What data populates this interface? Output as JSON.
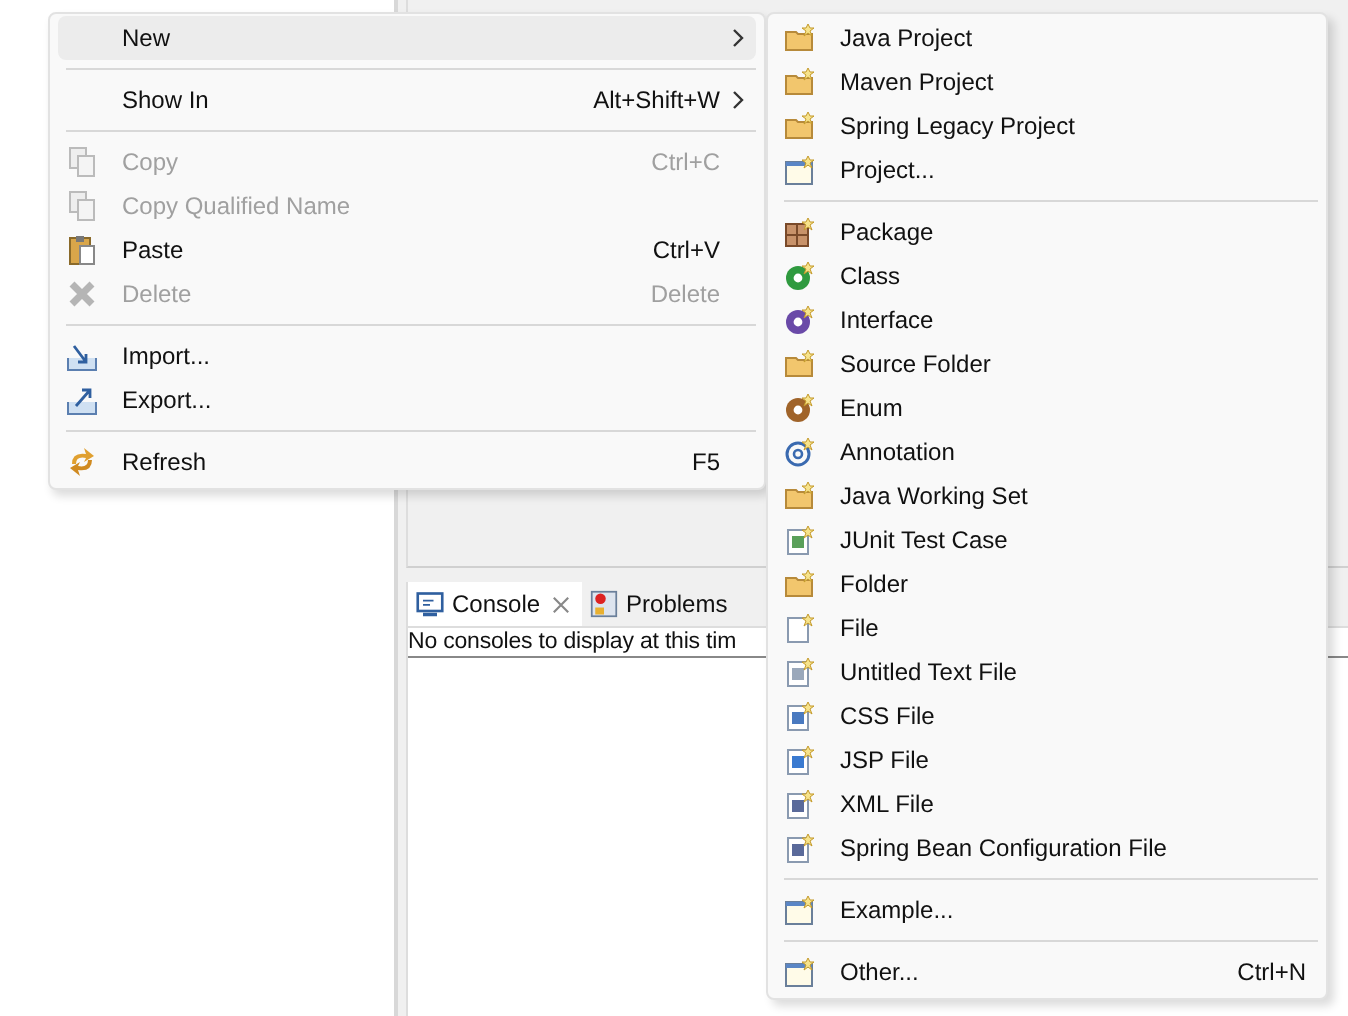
{
  "context_menu": {
    "groups": [
      [
        {
          "label": "New",
          "disabled": false,
          "selected": true,
          "submenu": true
        }
      ],
      [
        {
          "label": "Show In",
          "shortcut": "Alt+Shift+W",
          "disabled": false,
          "selected": false,
          "submenu": true
        }
      ],
      [
        {
          "label": "Copy",
          "shortcut": "Ctrl+C",
          "disabled": true,
          "selected": false,
          "submenu": false
        },
        {
          "label": "Copy Qualified Name",
          "disabled": true,
          "selected": false,
          "submenu": false
        },
        {
          "label": "Paste",
          "shortcut": "Ctrl+V",
          "disabled": false,
          "selected": false,
          "submenu": false
        },
        {
          "label": "Delete",
          "shortcut": "Delete",
          "disabled": true,
          "selected": false,
          "submenu": false
        }
      ],
      [
        {
          "label": "Import...",
          "disabled": false,
          "selected": false,
          "submenu": false
        },
        {
          "label": "Export...",
          "disabled": false,
          "selected": false,
          "submenu": false
        }
      ],
      [
        {
          "label": "Refresh",
          "shortcut": "F5",
          "disabled": false,
          "selected": false,
          "submenu": false
        }
      ]
    ]
  },
  "submenu": {
    "groups": [
      [
        {
          "label": "Java Project"
        },
        {
          "label": "Maven Project"
        },
        {
          "label": "Spring Legacy Project"
        },
        {
          "label": "Project..."
        }
      ],
      [
        {
          "label": "Package"
        },
        {
          "label": "Class"
        },
        {
          "label": "Interface"
        },
        {
          "label": "Source Folder"
        },
        {
          "label": "Enum"
        },
        {
          "label": "Annotation"
        },
        {
          "label": "Java Working Set"
        },
        {
          "label": "JUnit Test Case"
        },
        {
          "label": "Folder"
        },
        {
          "label": "File"
        },
        {
          "label": "Untitled Text File"
        },
        {
          "label": "CSS File"
        },
        {
          "label": "JSP File"
        },
        {
          "label": "XML File"
        },
        {
          "label": "Spring Bean Configuration File"
        }
      ],
      [
        {
          "label": "Example..."
        }
      ],
      [
        {
          "label": "Other...",
          "shortcut": "Ctrl+N"
        }
      ]
    ]
  },
  "console_view": {
    "tabs": [
      {
        "label": "Console",
        "selected": true,
        "closable": true
      },
      {
        "label": "Problems",
        "selected": false,
        "closable": false
      }
    ],
    "message": "No consoles to display at this tim"
  }
}
